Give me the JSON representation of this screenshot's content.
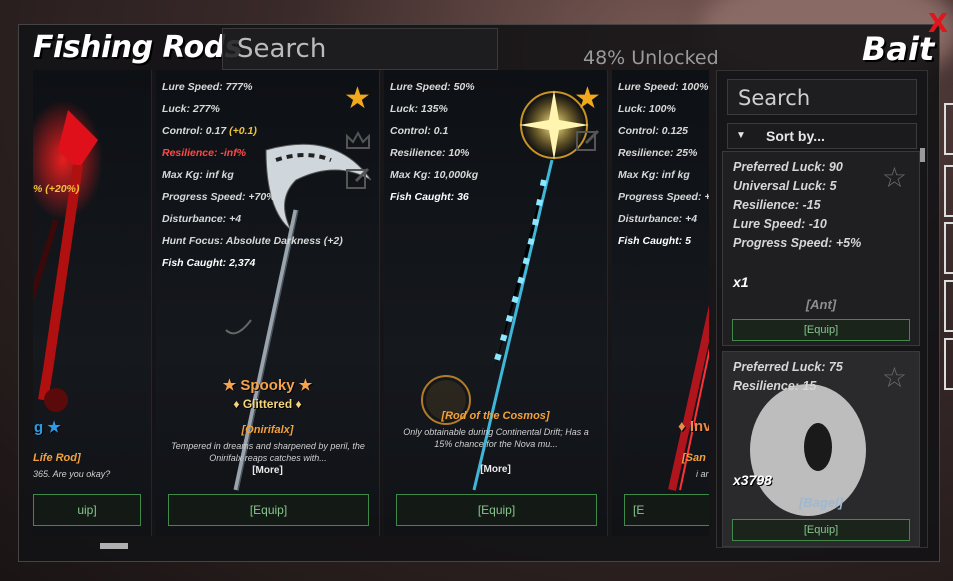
{
  "header": {
    "title": "Fishing Rods",
    "search_placeholder": "Search",
    "unlocked": "48% Unlocked",
    "bait_title": "Bait",
    "close": "X"
  },
  "rods": [
    {
      "stats": [
        {
          "text": "% (+20%)",
          "style": "bonus"
        }
      ],
      "badge": "ed Song ★",
      "name": "Life Rod]",
      "desc": "365. Are you okay?",
      "equip": "uip]"
    },
    {
      "stats": [
        {
          "text": "Lure Speed: 777%",
          "style": ""
        },
        {
          "text": "Luck: 277%",
          "style": ""
        },
        {
          "label": "Control: 0.17 ",
          "bonus": "(+0.1)"
        },
        {
          "text": "Resilience: -inf%",
          "style": "red"
        },
        {
          "text": "Max Kg: inf kg",
          "style": ""
        },
        {
          "text": "Progress Speed: +70%",
          "style": ""
        },
        {
          "text": "Disturbance: +4",
          "style": ""
        },
        {
          "text": "Hunt Focus: Absolute Darkness (+2)",
          "style": ""
        },
        {
          "text": "Fish Caught: 2,374",
          "style": "white"
        }
      ],
      "badge": "★ Spooky ★",
      "subbadge": "♦ Glittered ♦",
      "name": "[Onirifalx]",
      "desc": "Tempered in dreams and sharpened by peril, the Onirifalx reaps catches with...",
      "more": "[More]",
      "equip": "[Equip]"
    },
    {
      "stats": [
        {
          "text": "Lure Speed: 50%",
          "style": ""
        },
        {
          "text": "Luck: 135%",
          "style": ""
        },
        {
          "text": "Control: 0.1",
          "style": ""
        },
        {
          "text": "Resilience: 10%",
          "style": ""
        },
        {
          "text": "Max Kg: 10,000kg",
          "style": ""
        },
        {
          "text": "Fish Caught: 36",
          "style": "white"
        }
      ],
      "name": "[Rod of the Cosmos]",
      "desc": "Only obtainable during Continental Drift; Has a 15% chance for the Nova mu...",
      "more": "[More]",
      "equip": "[Equip]"
    },
    {
      "stats": [
        {
          "text": "Lure Speed: 100%",
          "style": ""
        },
        {
          "text": "Luck: 100%",
          "style": ""
        },
        {
          "text": "Control: 0.125",
          "style": ""
        },
        {
          "text": "Resilience: 25%",
          "style": ""
        },
        {
          "text": "Max Kg: inf kg",
          "style": ""
        },
        {
          "text": "Progress Speed: +",
          "style": ""
        },
        {
          "text": "Disturbance: +4",
          "style": ""
        },
        {
          "text": "Fish Caught: 5",
          "style": "white"
        }
      ],
      "badge": "♦ Inv",
      "name": "[San",
      "desc": "i ar",
      "equip": "[E"
    }
  ],
  "bait": {
    "search_placeholder": "Search",
    "sort_label": "Sort by...",
    "items": [
      {
        "stats": [
          "Preferred Luck: 90",
          "Universal Luck: 5",
          "Resilience: -15",
          "Lure Speed: -10",
          "Progress Speed: +5%"
        ],
        "qty": "x1",
        "name": "[Ant]",
        "equip": "[Equip]"
      },
      {
        "stats": [
          "Preferred Luck: 75",
          "Resilience: 15"
        ],
        "qty": "x3798",
        "name": "[Bagel]",
        "equip": "[Equip]"
      }
    ]
  },
  "colors": {
    "favorite": "#f1a81c",
    "close": "#e0161c",
    "equip_text": "#86c58c",
    "rod_name": "#f3a13a"
  }
}
